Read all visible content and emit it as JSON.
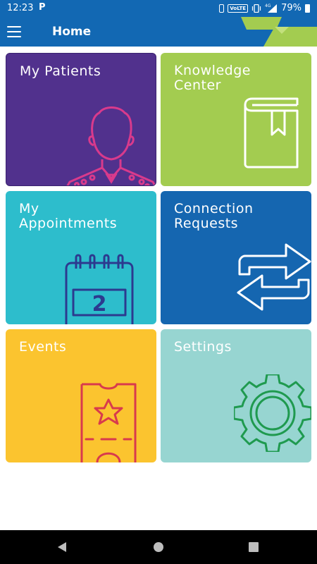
{
  "status_bar": {
    "time": "12:23",
    "notification_icon": "P",
    "volte": "VoLTE",
    "network": "4G",
    "battery": "79%"
  },
  "app_bar": {
    "title": "Home",
    "menu_icon": "hamburger-menu-icon"
  },
  "tiles": [
    {
      "label": "My Patients",
      "color": "#51318d",
      "icon": "patient-icon"
    },
    {
      "label": "Knowledge\nCenter",
      "color": "#a3cc50",
      "icon": "book-icon"
    },
    {
      "label": "My\nAppointments",
      "color": "#2dbdcc",
      "icon": "calendar-icon",
      "icon_text": "2"
    },
    {
      "label": "Connection\nRequests",
      "color": "#1566b0",
      "icon": "swap-arrows-icon"
    },
    {
      "label": "Events",
      "color": "#fbc42f",
      "icon": "ticket-icon"
    },
    {
      "label": "Settings",
      "color": "#97d5d1",
      "icon": "gear-icon"
    }
  ],
  "nav_bar": {
    "back": "back-icon",
    "home": "home-icon",
    "recents": "recents-icon"
  }
}
